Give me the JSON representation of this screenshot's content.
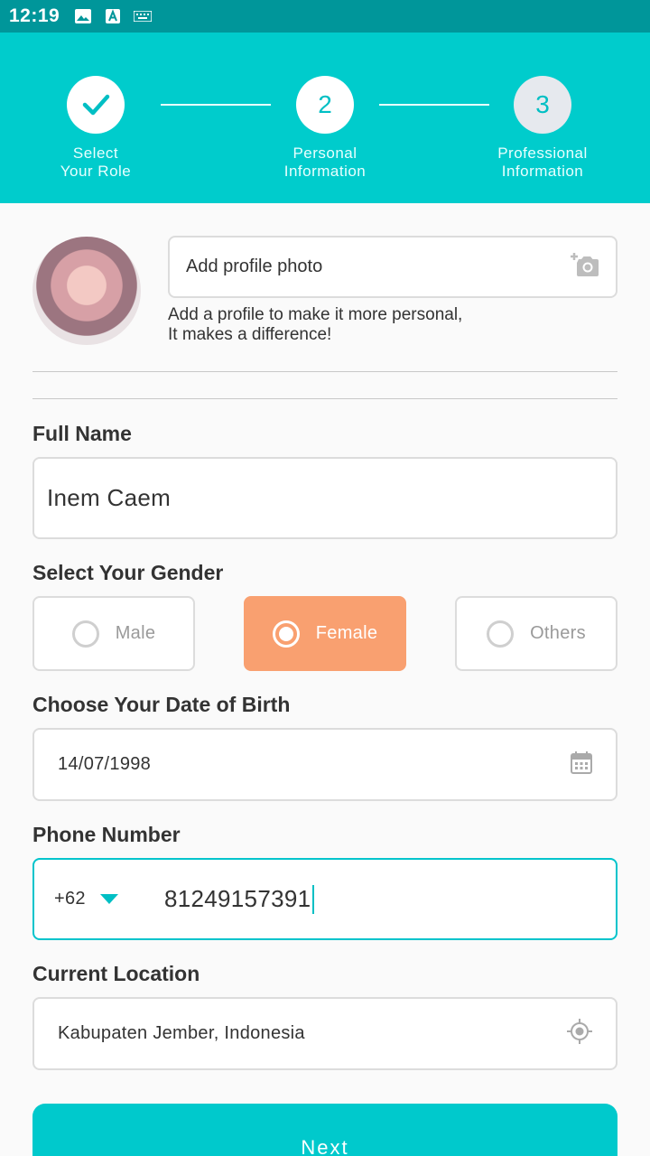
{
  "status_bar": {
    "time": "12:19",
    "icons": [
      "image-icon",
      "font-a-icon",
      "keyboard-icon"
    ]
  },
  "stepper": {
    "steps": [
      {
        "line1": "Select",
        "line2": "Your Role",
        "state": "done"
      },
      {
        "number": "2",
        "line1": "Personal",
        "line2": "Information",
        "state": "current"
      },
      {
        "number": "3",
        "line1": "Professional",
        "line2": "Information",
        "state": "pending"
      }
    ]
  },
  "profile": {
    "add_photo_label": "Add profile photo",
    "hint_line1": "Add a profile to make it more personal,",
    "hint_line2": "It makes a difference!"
  },
  "full_name": {
    "label": "Full Name",
    "value": "Inem Caem"
  },
  "gender": {
    "label": "Select Your Gender",
    "options": [
      "Male",
      "Female",
      "Others"
    ],
    "selected": "Female"
  },
  "dob": {
    "label": "Choose Your Date of Birth",
    "value": "14/07/1998"
  },
  "phone": {
    "label": "Phone Number",
    "country_code": "+62",
    "number": "81249157391"
  },
  "location": {
    "label": "Current Location",
    "value": "Kabupaten Jember, Indonesia"
  },
  "next_button": {
    "label": "Next"
  },
  "colors": {
    "primary": "#00cccc",
    "status_bar": "#00969a",
    "selected_gender": "#f9a070"
  }
}
